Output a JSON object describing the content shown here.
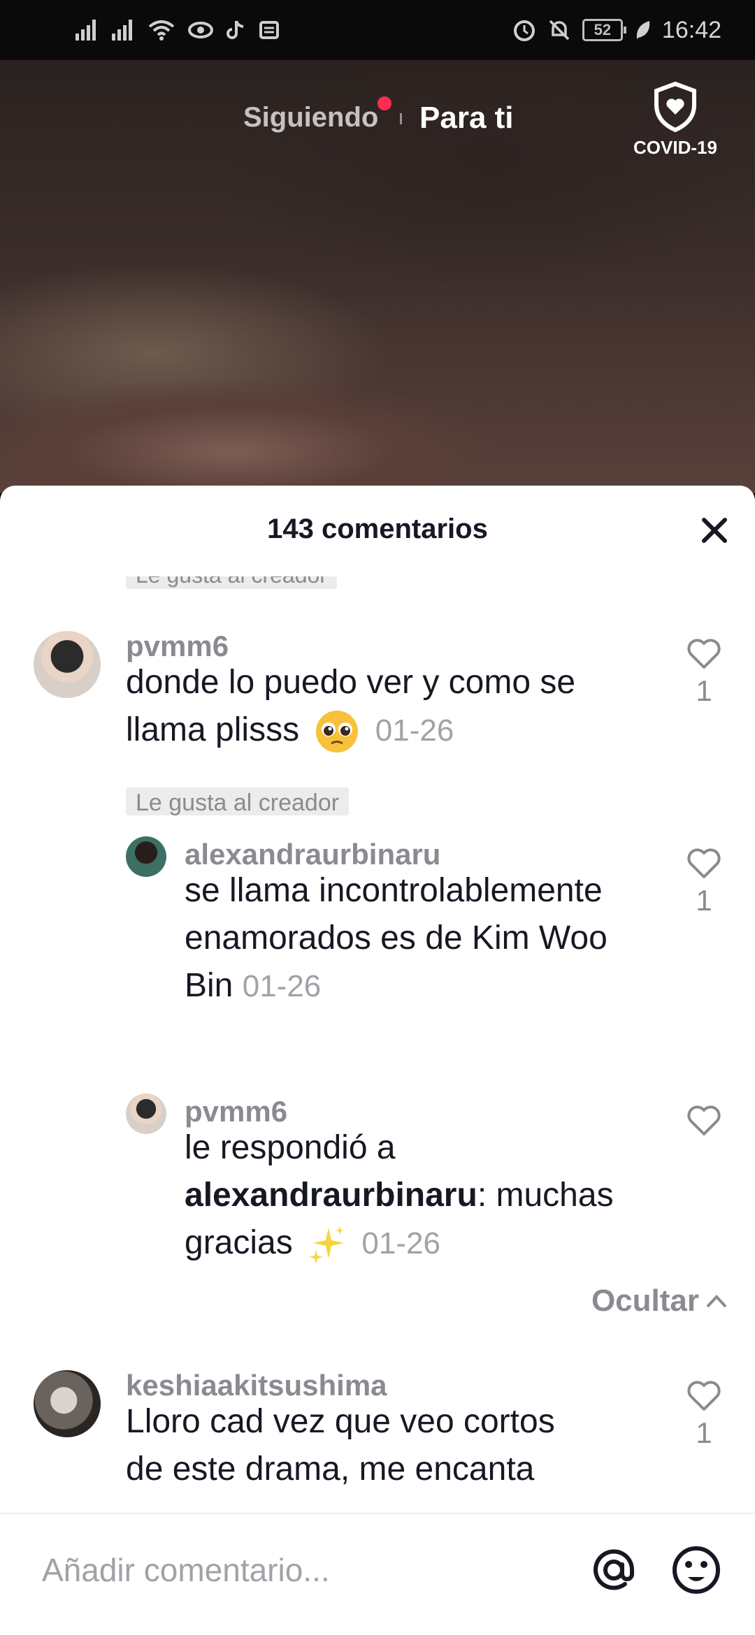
{
  "status_bar": {
    "time": "16:42",
    "battery": "52",
    "left_icons": [
      "signal-icon",
      "signal-icon",
      "wifi-icon",
      "eye-icon",
      "tiktok-icon",
      "message-icon"
    ],
    "right_icons": [
      "alarm-icon",
      "bell-off-icon",
      "battery-icon",
      "leaf-icon"
    ]
  },
  "top_nav": {
    "following": "Siguiendo",
    "for_you": "Para ti",
    "covid": "COVID-19",
    "colors": {
      "notification_dot": "#fe2c55"
    }
  },
  "sheet": {
    "title": "143 comentarios",
    "partial_tag": "Le gusta al creador",
    "comments": [
      {
        "username": "pvmm6",
        "text": "donde lo puedo ver y como se llama plisss",
        "emoji": "pleading-face",
        "date": "01-26",
        "likes": "1",
        "creator_tag": "Le gusta al creador"
      },
      {
        "username": "alexandraurbinaru",
        "text": "se llama incontrolablemente enamorados es de Kim Woo Bin",
        "date": "01-26",
        "likes": "1"
      },
      {
        "username": "pvmm6",
        "reply_prefix": "le respondió a",
        "reply_to": "alexandraurbinaru",
        "reply_sep": ":",
        "text": "muchas gracias",
        "emoji": "sparkles",
        "date": "01-26",
        "likes": ""
      },
      {
        "username": "keshiaakitsushima",
        "text": "Lloro cad vez que veo cortos",
        "text_cut": "de este drama, me encanta",
        "likes": "1"
      }
    ],
    "hide_label": "Ocultar"
  },
  "input": {
    "placeholder": "Añadir comentario..."
  }
}
